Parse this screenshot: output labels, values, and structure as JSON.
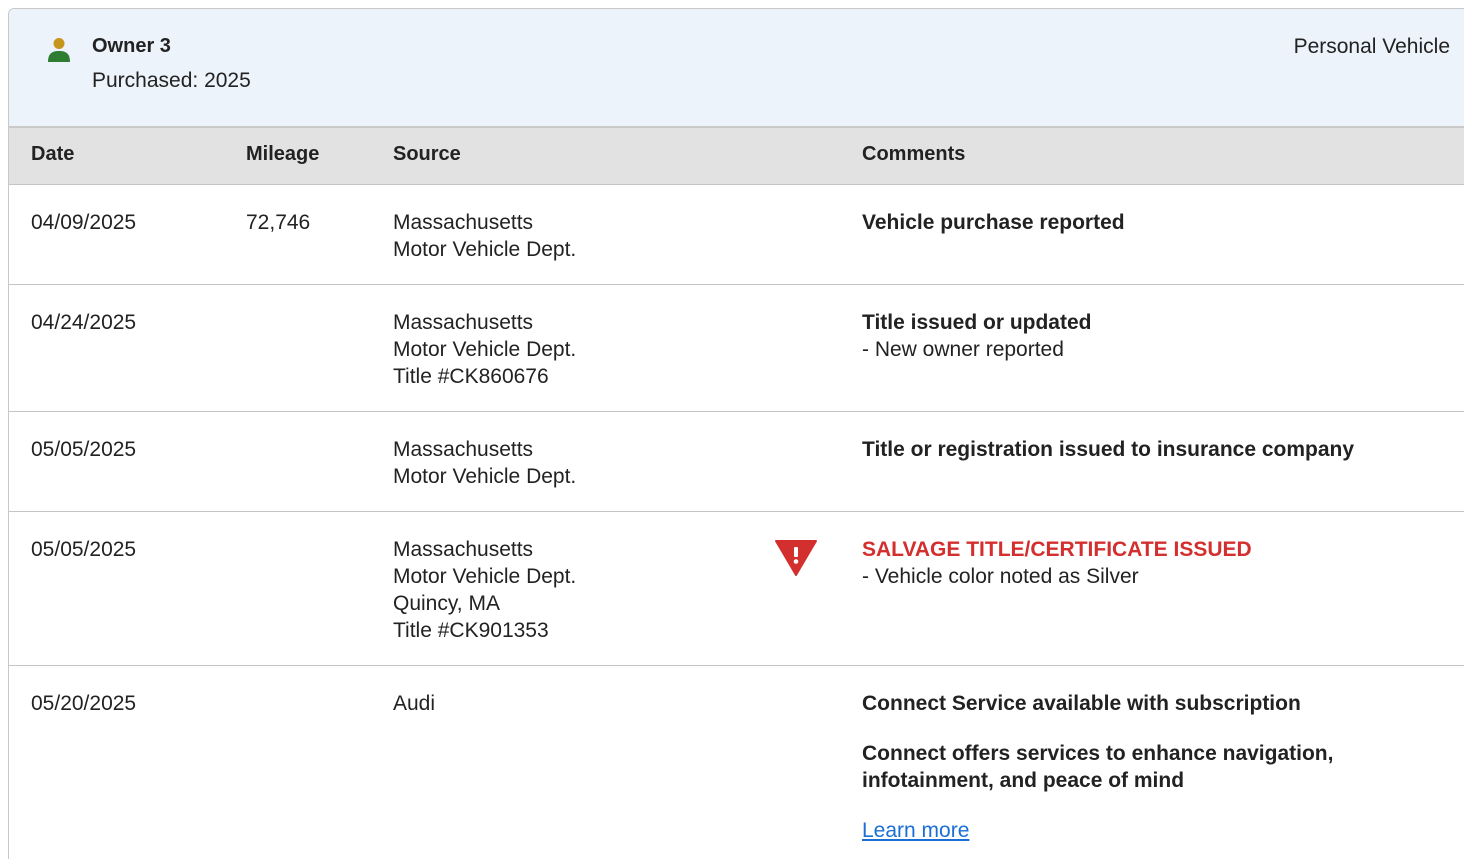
{
  "owner": {
    "icon": "person-icon",
    "name": "Owner 3",
    "purchased_label": "Purchased:",
    "purchased_year": "2025",
    "vehicle_use": "Personal Vehicle",
    "icon_colors": {
      "head": "#c7941c",
      "body": "#2e7d32"
    }
  },
  "table": {
    "headers": {
      "date": "Date",
      "mileage": "Mileage",
      "source": "Source",
      "comments": "Comments"
    },
    "rows": [
      {
        "date": "04/09/2025",
        "mileage": "72,746",
        "source": [
          "Massachusetts",
          "Motor Vehicle Dept."
        ],
        "comment_title": "Vehicle purchase reported"
      },
      {
        "date": "04/24/2025",
        "mileage": "",
        "source": [
          "Massachusetts",
          "Motor Vehicle Dept.",
          "Title #CK860676"
        ],
        "comment_title": "Title issued or updated",
        "comment_detail": "- New owner reported"
      },
      {
        "date": "05/05/2025",
        "mileage": "",
        "source": [
          "Massachusetts",
          "Motor Vehicle Dept."
        ],
        "comment_title": "Title or registration issued to insurance company"
      },
      {
        "date": "05/05/2025",
        "mileage": "",
        "source": [
          "Massachusetts",
          "Motor Vehicle Dept.",
          "Quincy, MA",
          "Title #CK901353"
        ],
        "alert_icon": "warning-triangle-icon",
        "comment_title": "SALVAGE TITLE/CERTIFICATE ISSUED",
        "comment_detail": "- Vehicle color noted as Silver"
      },
      {
        "date": "05/20/2025",
        "mileage": "",
        "source": [
          "Audi"
        ],
        "comment_title": "Connect Service available with subscription",
        "comment_para": "Connect offers services to enhance navigation, infotainment, and peace of mind",
        "link": "Learn more"
      }
    ]
  },
  "colors": {
    "header_bg": "#edf3fa",
    "table_header_bg": "#e2e2e2",
    "alert": "#d32f2f",
    "link": "#1a6fd6"
  }
}
